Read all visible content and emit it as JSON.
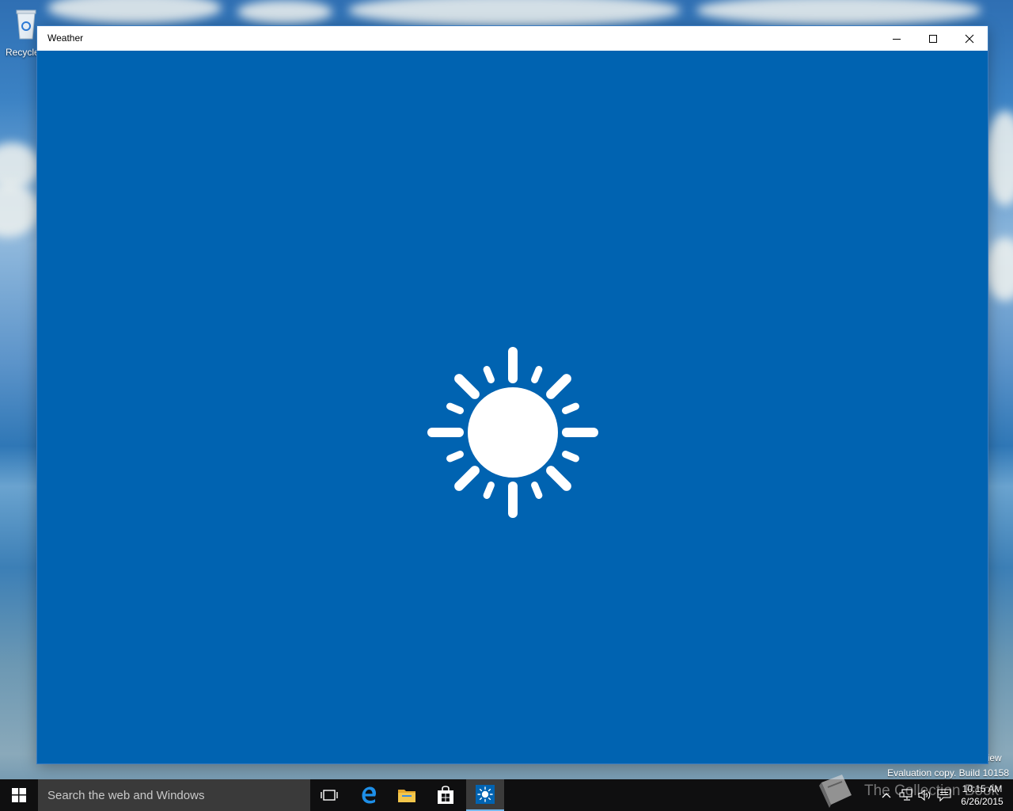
{
  "desktop": {
    "recycle_bin_label": "Recycle",
    "eval_watermark": "Evaluation copy. Build 10158",
    "watermark_edge": "eview",
    "collection_book": "The Collection Book"
  },
  "window": {
    "title": "Weather",
    "controls": {
      "minimize": "minimize-icon",
      "maximize": "maximize-icon",
      "close": "close-icon"
    },
    "background_color": "#0063b1",
    "splash_icon": "sun-icon"
  },
  "taskbar": {
    "search_placeholder": "Search the web and Windows",
    "pinned": [
      {
        "name": "task-view",
        "icon": "task-view-icon"
      },
      {
        "name": "edge",
        "icon": "edge-icon",
        "color": "#1e8fe8"
      },
      {
        "name": "file-explorer",
        "icon": "folder-icon",
        "color": "#f3c64b"
      },
      {
        "name": "store",
        "icon": "store-icon"
      },
      {
        "name": "weather",
        "icon": "sun-icon",
        "active": true
      }
    ],
    "clock": {
      "time": "10:15 AM",
      "date": "6/26/2015"
    },
    "colors": {
      "background": "#0f0f10",
      "search_background": "#3a3a3a",
      "active_indicator": "#76b9ed"
    }
  }
}
